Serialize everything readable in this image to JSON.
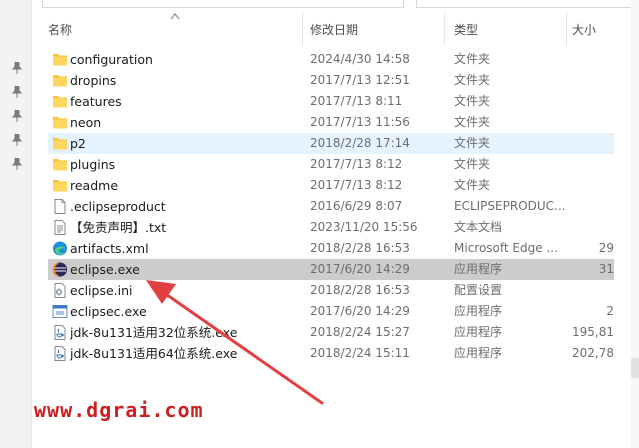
{
  "header": {
    "name": "名称",
    "date": "修改日期",
    "type": "类型",
    "size": "大小"
  },
  "files": [
    {
      "name": "configuration",
      "date": "2024/4/30 14:58",
      "type": "文件夹",
      "size": "",
      "icon": "folder-icon"
    },
    {
      "name": "dropins",
      "date": "2017/7/13 12:51",
      "type": "文件夹",
      "size": "",
      "icon": "folder-icon"
    },
    {
      "name": "features",
      "date": "2017/7/13 8:11",
      "type": "文件夹",
      "size": "",
      "icon": "folder-icon"
    },
    {
      "name": "neon",
      "date": "2017/7/13 11:56",
      "type": "文件夹",
      "size": "",
      "icon": "folder-icon"
    },
    {
      "name": "p2",
      "date": "2018/2/28 17:14",
      "type": "文件夹",
      "size": "",
      "icon": "folder-icon"
    },
    {
      "name": "plugins",
      "date": "2017/7/13 8:12",
      "type": "文件夹",
      "size": "",
      "icon": "folder-icon"
    },
    {
      "name": "readme",
      "date": "2017/7/13 8:12",
      "type": "文件夹",
      "size": "",
      "icon": "folder-icon"
    },
    {
      "name": ".eclipseproduct",
      "date": "2016/6/29 8:07",
      "type": "ECLIPSEPRODUC...",
      "size": "",
      "icon": "file-icon"
    },
    {
      "name": "【免责声明】.txt",
      "date": "2023/11/20 15:56",
      "type": "文本文档",
      "size": "",
      "icon": "text-file-icon"
    },
    {
      "name": "artifacts.xml",
      "date": "2018/2/28 16:53",
      "type": "Microsoft Edge ...",
      "size": "29",
      "icon": "edge-icon"
    },
    {
      "name": "eclipse.exe",
      "date": "2017/6/20 14:29",
      "type": "应用程序",
      "size": "31",
      "icon": "eclipse-icon"
    },
    {
      "name": "eclipse.ini",
      "date": "2018/2/28 16:53",
      "type": "配置设置",
      "size": "",
      "icon": "settings-file-icon"
    },
    {
      "name": "eclipsec.exe",
      "date": "2017/6/20 14:29",
      "type": "应用程序",
      "size": "2",
      "icon": "app-icon"
    },
    {
      "name": "jdk-8u131适用32位系统.exe",
      "date": "2018/2/24 15:27",
      "type": "应用程序",
      "size": "195,81",
      "icon": "java-installer-icon"
    },
    {
      "name": "jdk-8u131适用64位系统.exe",
      "date": "2018/2/24 15:11",
      "type": "应用程序",
      "size": "202,78",
      "icon": "java-installer-icon"
    }
  ],
  "selected_row": 10,
  "hover_row": 4,
  "watermark": "www.dgrai.com",
  "colors": {
    "folder": "#f5c242",
    "selected": "#cccccc",
    "hover": "#e5f3ff",
    "watermark": "#cc1f1f",
    "arrow": "#e04040"
  }
}
